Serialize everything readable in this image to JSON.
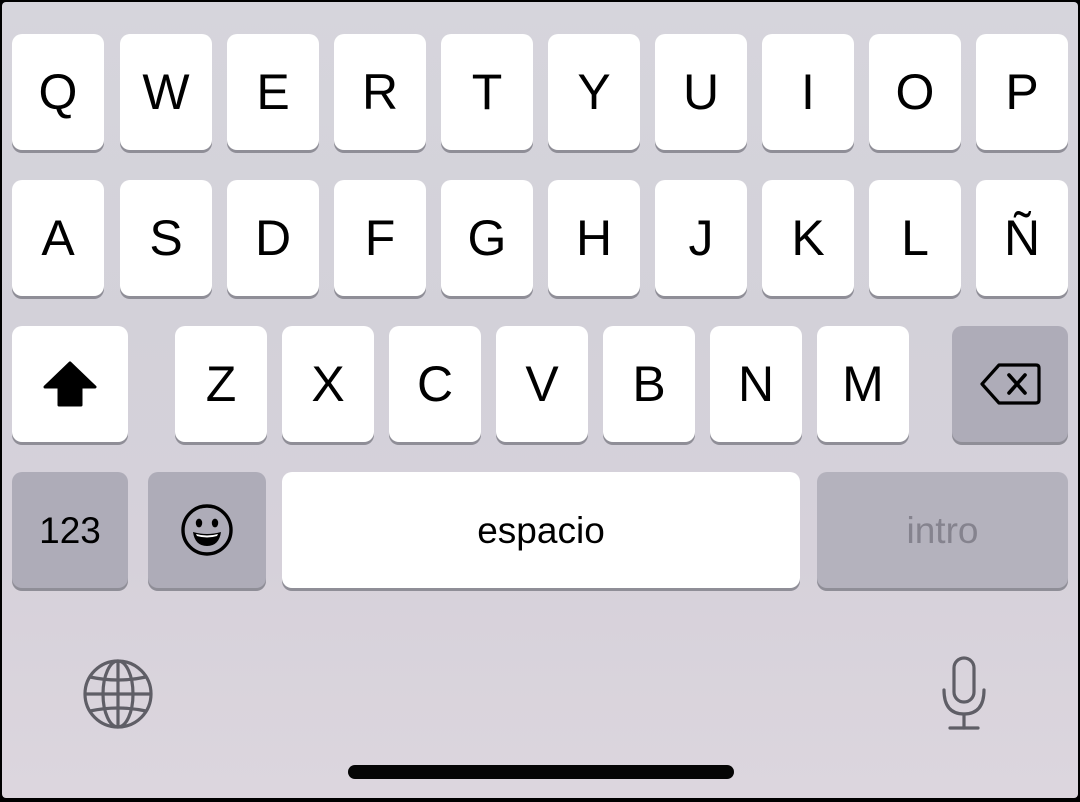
{
  "keyboard": {
    "row1": [
      "Q",
      "W",
      "E",
      "R",
      "T",
      "Y",
      "U",
      "I",
      "O",
      "P"
    ],
    "row2": [
      "A",
      "S",
      "D",
      "F",
      "G",
      "H",
      "J",
      "K",
      "L",
      "Ñ"
    ],
    "row3": [
      "Z",
      "X",
      "C",
      "V",
      "B",
      "N",
      "M"
    ],
    "numbers_label": "123",
    "space_label": "espacio",
    "return_label": "intro",
    "icons": {
      "shift": "shift-arrow-up-icon",
      "delete": "backspace-icon",
      "emoji": "smiley-face-icon",
      "language": "globe-icon",
      "dictation": "microphone-icon"
    },
    "colors": {
      "background": "#d5d3db",
      "letter_key": "#ffffff",
      "modifier_key": "#aeacb8",
      "key_shadow": "#8f8e97",
      "return_text_disabled": "#85838e",
      "home_indicator": "#050505"
    }
  }
}
